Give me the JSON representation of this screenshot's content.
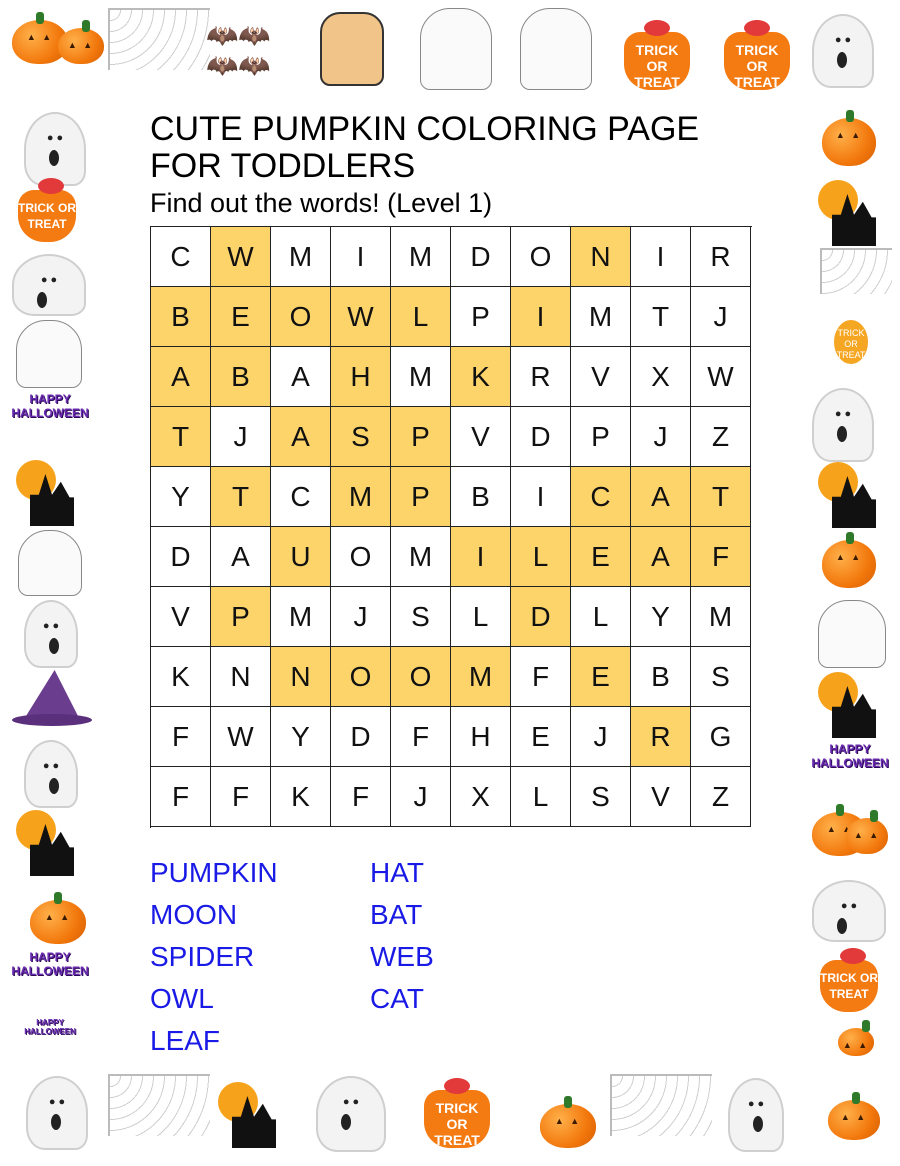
{
  "title": "CUTE PUMPKIN COLORING PAGE FOR TODDLERS",
  "subtitle": "Find out the words! (Level 1)",
  "colors": {
    "highlight": "#fdd46a",
    "word_list": "#1a1ae6",
    "grid_line": "#222222"
  },
  "puzzle": {
    "rows": [
      [
        "C",
        "W",
        "M",
        "I",
        "M",
        "D",
        "O",
        "N",
        "I",
        "R"
      ],
      [
        "B",
        "E",
        "O",
        "W",
        "L",
        "P",
        "I",
        "M",
        "T",
        "J"
      ],
      [
        "A",
        "B",
        "A",
        "H",
        "M",
        "K",
        "R",
        "V",
        "X",
        "W"
      ],
      [
        "T",
        "J",
        "A",
        "S",
        "P",
        "V",
        "D",
        "P",
        "J",
        "Z"
      ],
      [
        "Y",
        "T",
        "C",
        "M",
        "P",
        "B",
        "I",
        "C",
        "A",
        "T"
      ],
      [
        "D",
        "A",
        "U",
        "O",
        "M",
        "I",
        "L",
        "E",
        "A",
        "F"
      ],
      [
        "V",
        "P",
        "M",
        "J",
        "S",
        "L",
        "D",
        "L",
        "Y",
        "M"
      ],
      [
        "K",
        "N",
        "N",
        "O",
        "O",
        "M",
        "F",
        "E",
        "B",
        "S"
      ],
      [
        "F",
        "W",
        "Y",
        "D",
        "F",
        "H",
        "E",
        "J",
        "R",
        "G"
      ],
      [
        "F",
        "F",
        "K",
        "F",
        "J",
        "X",
        "L",
        "S",
        "V",
        "Z"
      ]
    ],
    "highlighted": [
      [
        0,
        1
      ],
      [
        0,
        7
      ],
      [
        1,
        0
      ],
      [
        1,
        1
      ],
      [
        1,
        2
      ],
      [
        1,
        3
      ],
      [
        1,
        4
      ],
      [
        1,
        6
      ],
      [
        2,
        0
      ],
      [
        2,
        1
      ],
      [
        2,
        3
      ],
      [
        2,
        5
      ],
      [
        3,
        0
      ],
      [
        3,
        2
      ],
      [
        3,
        3
      ],
      [
        3,
        4
      ],
      [
        4,
        1
      ],
      [
        4,
        3
      ],
      [
        4,
        4
      ],
      [
        4,
        7
      ],
      [
        4,
        8
      ],
      [
        4,
        9
      ],
      [
        5,
        2
      ],
      [
        5,
        5
      ],
      [
        5,
        6
      ],
      [
        5,
        7
      ],
      [
        5,
        8
      ],
      [
        5,
        9
      ],
      [
        6,
        1
      ],
      [
        6,
        6
      ],
      [
        7,
        2
      ],
      [
        7,
        3
      ],
      [
        7,
        4
      ],
      [
        7,
        5
      ],
      [
        7,
        7
      ],
      [
        8,
        8
      ]
    ]
  },
  "word_list": {
    "left": [
      "PUMPKIN",
      "MOON",
      "SPIDER",
      "OWL",
      "LEAF"
    ],
    "right": [
      "HAT",
      "BAT",
      "WEB",
      "CAT"
    ]
  },
  "decorations": {
    "trick_or_treat_text": "TRICK OR TREAT",
    "happy_halloween_text": "HAPPY HALLOWEEN",
    "icons": [
      "pumpkin-icon",
      "bats-icon",
      "spiderweb-icon",
      "mummy-cat-icon",
      "skeleton-sketch-icon",
      "witch-sketch-icon",
      "trick-or-treat-bucket-icon",
      "ghost-icon",
      "witch-hat-icon",
      "haunted-house-icon",
      "happy-halloween-icon",
      "balloon-icon",
      "ghost-cat-pumpkin-icon"
    ]
  }
}
